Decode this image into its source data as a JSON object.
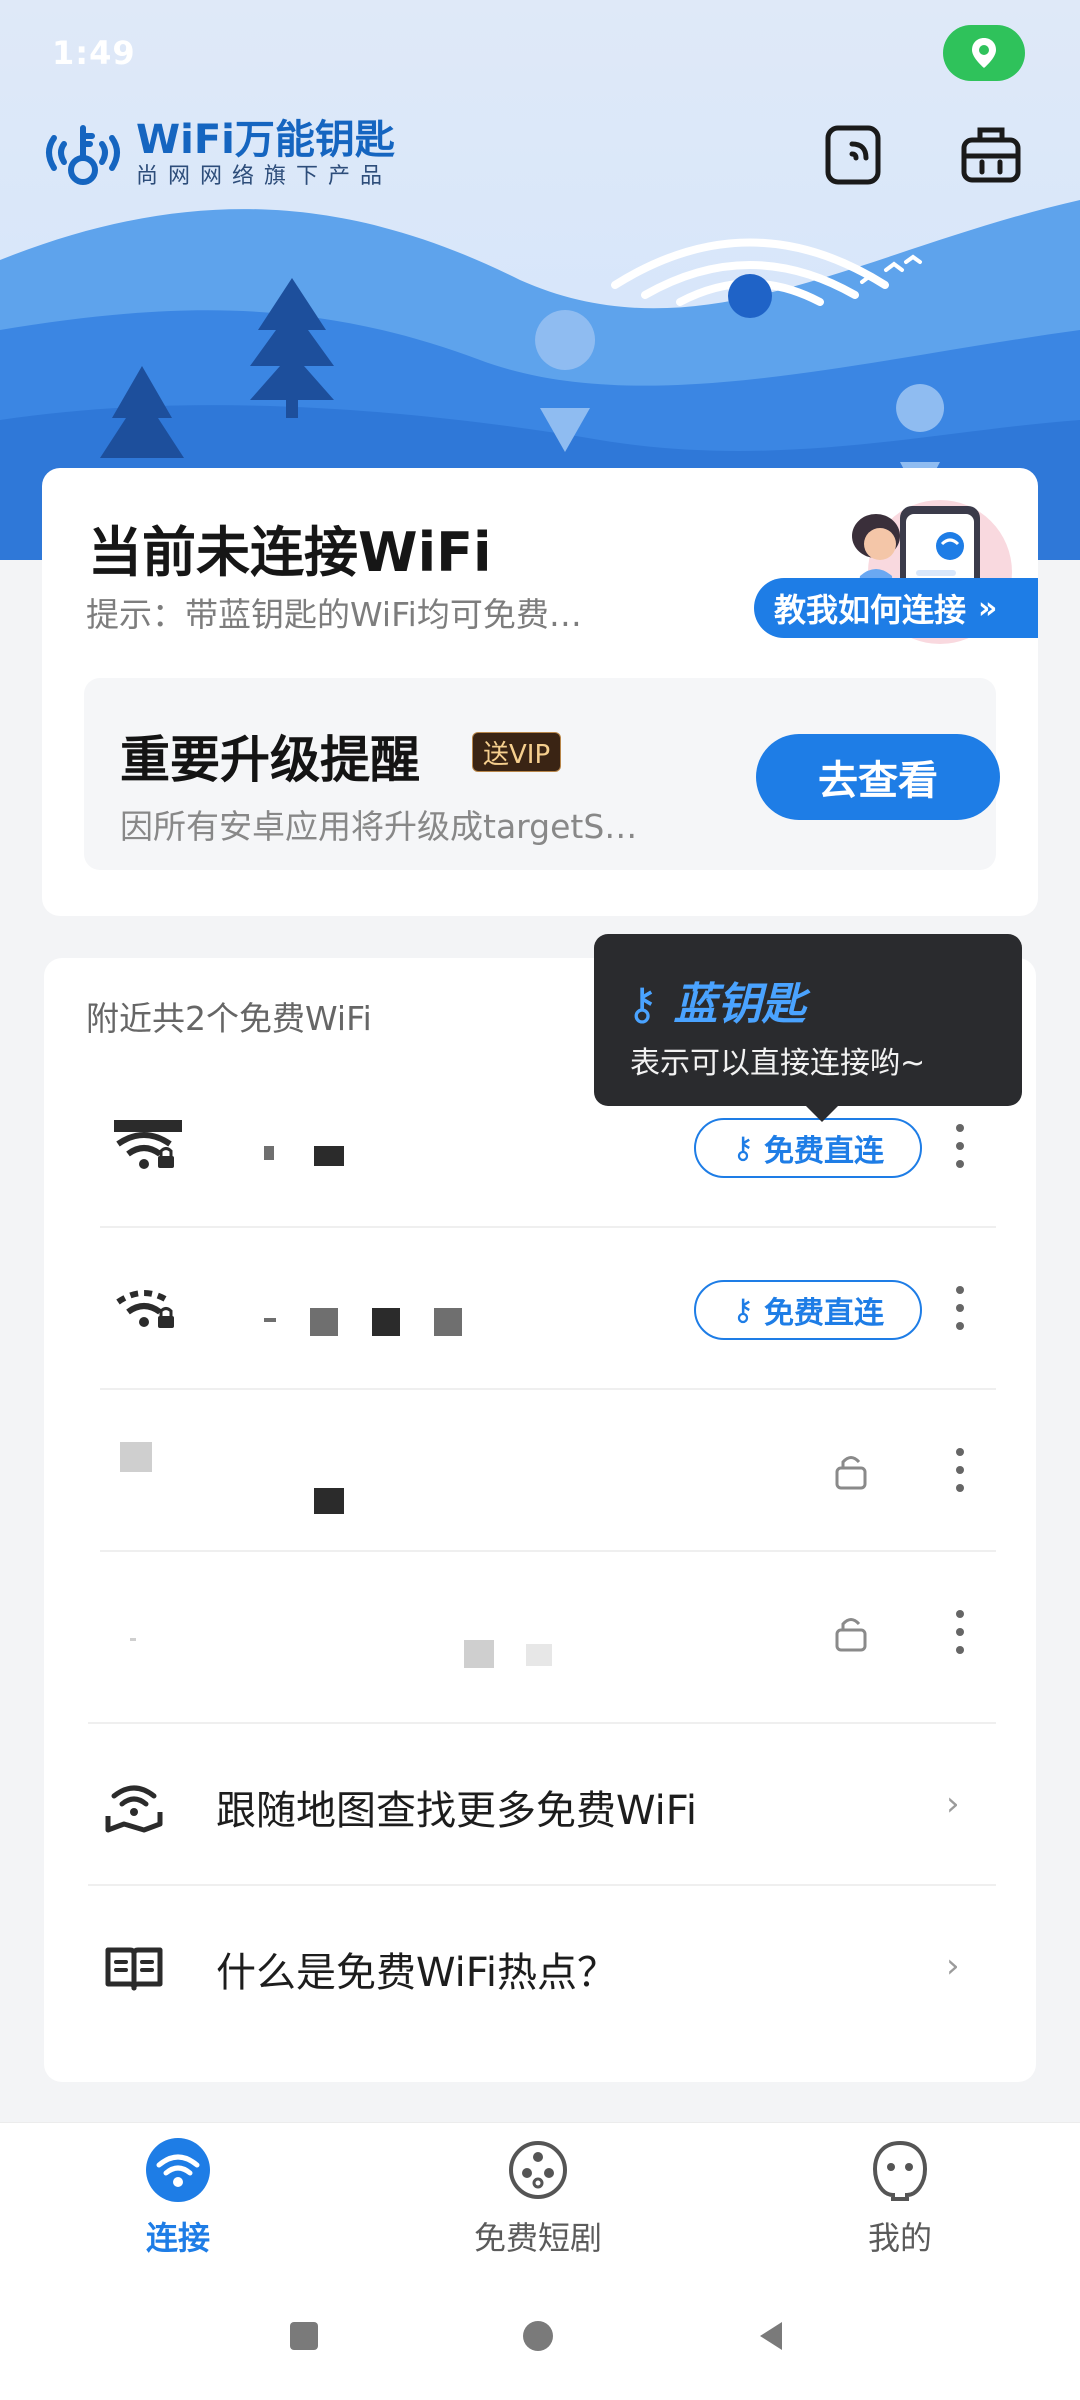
{
  "status_bar": {
    "time": "1:49"
  },
  "header": {
    "app_name": "WiFi万能钥匙",
    "app_subtitle": "尚网网络旗下产品"
  },
  "status_card": {
    "title": "当前未连接WiFi",
    "hint": "提示：带蓝钥匙的WiFi均可免费…",
    "teach_button": "教我如何连接",
    "upgrade": {
      "title": "重要升级提醒",
      "vip_tag": "送VIP",
      "description": "因所有安卓应用将升级成targetS…",
      "button": "去查看"
    }
  },
  "nearby": {
    "title": "附近共2个免费WiFi",
    "free_connect_label": "免费直连",
    "links": [
      {
        "label": "跟随地图查找更多免费WiFi"
      },
      {
        "label": "什么是免费WiFi热点？"
      }
    ]
  },
  "tooltip": {
    "title": "蓝钥匙",
    "description": "表示可以直接连接哟~"
  },
  "bottom_nav": [
    {
      "label": "连接",
      "icon": "wifi-icon",
      "active": true
    },
    {
      "label": "免费短剧",
      "icon": "film-reel-icon",
      "active": false
    },
    {
      "label": "我的",
      "icon": "profile-face-icon",
      "active": false
    }
  ],
  "colors": {
    "accent": "#1e7de6",
    "location_pill": "#2fc25b",
    "tooltip_bg": "#2a2b2e"
  }
}
